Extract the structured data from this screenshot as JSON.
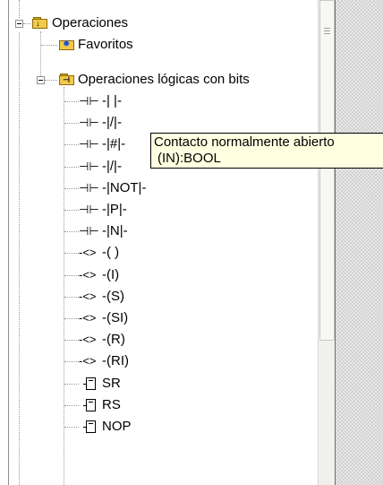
{
  "tree": {
    "root": {
      "label": "Operaciones",
      "icon": "folder-open-down-icon",
      "expanded": true
    },
    "favoritos": {
      "label": "Favoritos",
      "icon": "favorites-folder-icon"
    },
    "bit_logic": {
      "label": "Operaciones lógicas con bits",
      "icon": "folder-contacts-icon",
      "expanded": true
    },
    "items": [
      {
        "symbol": "⊣⊢",
        "label": "-| |-",
        "icon": "contact-icon"
      },
      {
        "symbol": "⊣⊢",
        "label": "-|/|-",
        "icon": "contact-icon"
      },
      {
        "symbol": "⊣⊢",
        "label": "-|#|-",
        "icon": "contact-icon"
      },
      {
        "symbol": "⊣⊢",
        "label": "-|/|-",
        "icon": "contact-icon"
      },
      {
        "symbol": "⊣⊢",
        "label": "-|NOT|-",
        "icon": "contact-icon"
      },
      {
        "symbol": "⊣⊢",
        "label": "-|P|-",
        "icon": "contact-icon"
      },
      {
        "symbol": "⊣⊢",
        "label": "-|N|-",
        "icon": "contact-icon"
      },
      {
        "symbol": "-<>",
        "label": "-( )",
        "icon": "coil-icon"
      },
      {
        "symbol": "-<>",
        "label": "-(I)",
        "icon": "coil-icon"
      },
      {
        "symbol": "-<>",
        "label": "-(S)",
        "icon": "coil-icon"
      },
      {
        "symbol": "-<>",
        "label": "-(SI)",
        "icon": "coil-icon"
      },
      {
        "symbol": "-<>",
        "label": "-(R)",
        "icon": "coil-icon"
      },
      {
        "symbol": "-<>",
        "label": "-(RI)",
        "icon": "coil-icon"
      },
      {
        "symbol": "",
        "label": "SR",
        "icon": "box-icon"
      },
      {
        "symbol": "",
        "label": "RS",
        "icon": "box-icon"
      },
      {
        "symbol": "",
        "label": "NOP",
        "icon": "box-icon"
      }
    ]
  },
  "tooltip": {
    "line1": "Contacto normalmente abierto",
    "line2": "(IN):BOOL"
  }
}
